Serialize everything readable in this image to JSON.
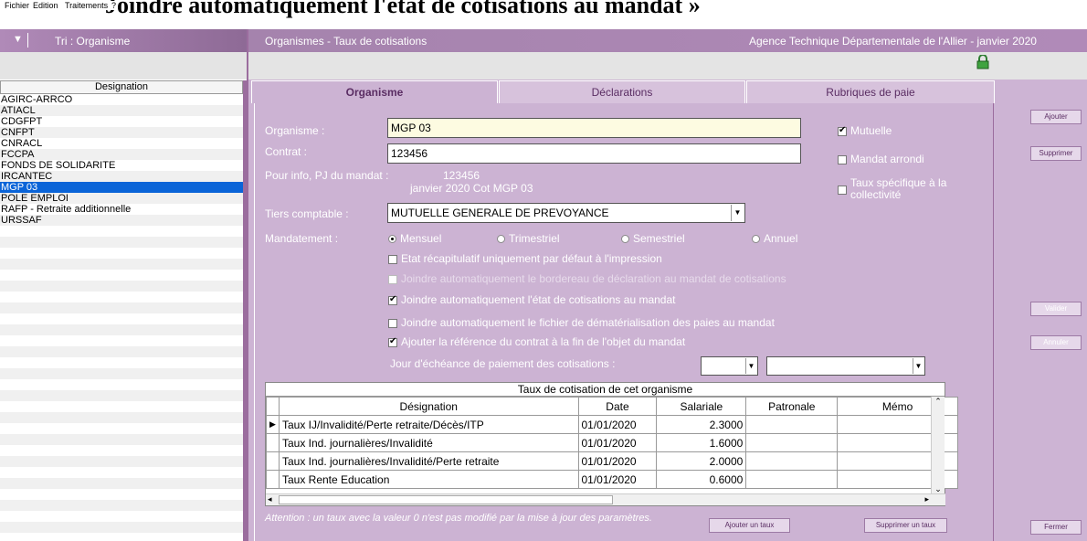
{
  "background_title": "Joindre automatiquement l'état de cotisations au mandat »",
  "menu": {
    "items": [
      "Fichier",
      "Edition",
      "Traitements",
      "?"
    ]
  },
  "left": {
    "header": "Tri : Organisme",
    "column": "Designation",
    "items": [
      "AGIRC-ARRCO",
      "ATIACL",
      "CDGFPT",
      "CNFPT",
      "CNRACL",
      "FCCPA",
      "FONDS DE SOLIDARITE",
      "IRCANTEC",
      "MGP 03",
      "POLE EMPLOI",
      "RAFP - Retraite additionnelle",
      "URSSAF"
    ],
    "selected": "MGP 03"
  },
  "header": {
    "title": "Organismes - Taux de cotisations",
    "agency": "Agence Technique Départementale de l'Allier - janvier 2020",
    "lock_icon": "lock-icon"
  },
  "tabs": [
    "Organisme",
    "Déclarations",
    "Rubriques de paie"
  ],
  "form": {
    "organisme_label": "Organisme :",
    "organisme_value": "MGP 03",
    "contrat_label": "Contrat :",
    "contrat_value": "123456",
    "pourinfo_label": "Pour info, PJ du mandat :",
    "pourinfo_line1": "123456",
    "pourinfo_line2": "janvier 2020 Cot MGP 03",
    "tiers_label": "Tiers comptable :",
    "tiers_value": "MUTUELLE GENERALE DE PREVOYANCE",
    "mandatement_label": "Mandatement :",
    "radio": [
      "Mensuel",
      "Trimestriel",
      "Semestriel",
      "Annuel"
    ],
    "checks": [
      "Etat récapitulatif uniquement par défaut à l'impression",
      "Joindre automatiquement le bordereau de déclaration au mandat de cotisations",
      "Joindre automatiquement l'état de cotisations au mandat",
      "Joindre automatiquement le fichier de dématérialisation des paies au mandat",
      "Ajouter la référence du contrat à la fin de l'objet du mandat"
    ],
    "echeance_label": "Jour d'échéance de paiement des cotisations :",
    "mutuelle": "Mutuelle",
    "mandat_arrondi": "Mandat arrondi",
    "taux_specifique": "Taux spécifique à la collectivité"
  },
  "table": {
    "title": "Taux de cotisation de cet organisme",
    "columns": [
      "Désignation",
      "Date",
      "Salariale",
      "Patronale",
      "Mémo"
    ],
    "rows": [
      [
        "Taux IJ/Invalidité/Perte retraite/Décès/ITP",
        "01/01/2020",
        "2.3000",
        "",
        ""
      ],
      [
        "Taux Ind. journalières/Invalidité",
        "01/01/2020",
        "1.6000",
        "",
        ""
      ],
      [
        "Taux Ind. journalières/Invalidité/Perte retraite",
        "01/01/2020",
        "2.0000",
        "",
        ""
      ],
      [
        "Taux Rente Education",
        "01/01/2020",
        "0.6000",
        "",
        ""
      ]
    ]
  },
  "footer": {
    "attention": "Attention : un taux avec la valeur 0 n'est pas modifié par la mise à jour des paramètres.",
    "add_rate": "Ajouter un taux",
    "delete_rate": "Supprimer un taux"
  },
  "side_buttons": {
    "add": "Ajouter",
    "delete": "Supprimer",
    "validate": "Valider",
    "cancel": "Annuler",
    "close": "Fermer"
  }
}
